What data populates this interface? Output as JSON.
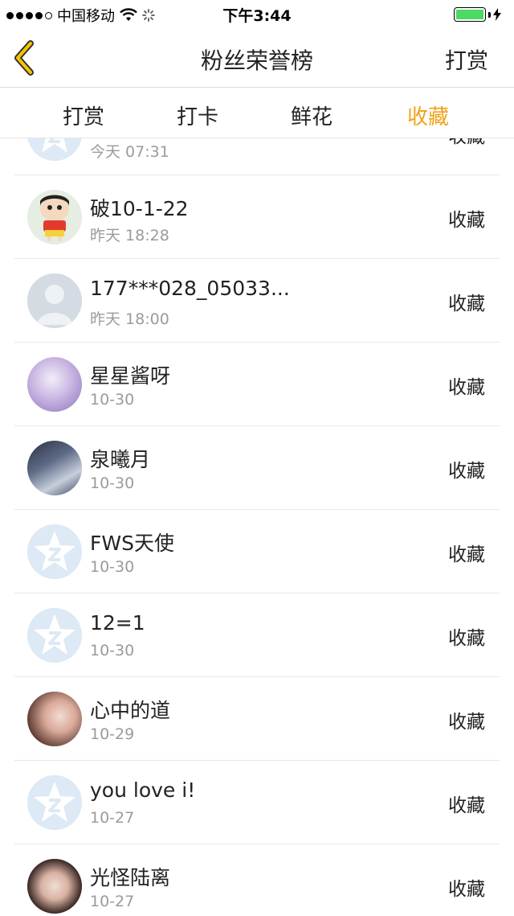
{
  "status_bar": {
    "carrier": "中国移动",
    "time": "下午3:44"
  },
  "nav": {
    "title": "粉丝荣誉榜",
    "right_label": "打赏"
  },
  "tabs": [
    {
      "label": "打赏",
      "active": false
    },
    {
      "label": "打卡",
      "active": false
    },
    {
      "label": "鲜花",
      "active": false
    },
    {
      "label": "收藏",
      "active": true
    }
  ],
  "colors": {
    "accent": "#f0a21a",
    "battery": "#4cd964",
    "default_avatar_bg": "#dde9f4",
    "default_avatar_star": "#ffffff"
  },
  "rows": [
    {
      "name": "",
      "time": "今天 07:31",
      "action": "收藏",
      "avatar": "default-star-icon"
    },
    {
      "name": "破10-1-22",
      "time": "昨天 18:28",
      "action": "收藏",
      "avatar": "cartoon"
    },
    {
      "name": "177***028_05033...",
      "time": "昨天 18:00",
      "action": "收藏",
      "avatar": "default-person-icon"
    },
    {
      "name": "星星酱呀",
      "time": "10-30",
      "action": "收藏",
      "avatar": "photo-purple"
    },
    {
      "name": "泉曦月",
      "time": "10-30",
      "action": "收藏",
      "avatar": "photo-dark"
    },
    {
      "name": "FWS天使",
      "time": "10-30",
      "action": "收藏",
      "avatar": "default-star-icon"
    },
    {
      "name": "12=1",
      "time": "10-30",
      "action": "收藏",
      "avatar": "default-star-icon"
    },
    {
      "name": "心中的道",
      "time": "10-29",
      "action": "收藏",
      "avatar": "photo-girl"
    },
    {
      "name": "you love i!",
      "time": "10-27",
      "action": "收藏",
      "avatar": "default-star-icon"
    },
    {
      "name": "光怪陆离",
      "time": "10-27",
      "action": "收藏",
      "avatar": "photo-girl"
    }
  ]
}
